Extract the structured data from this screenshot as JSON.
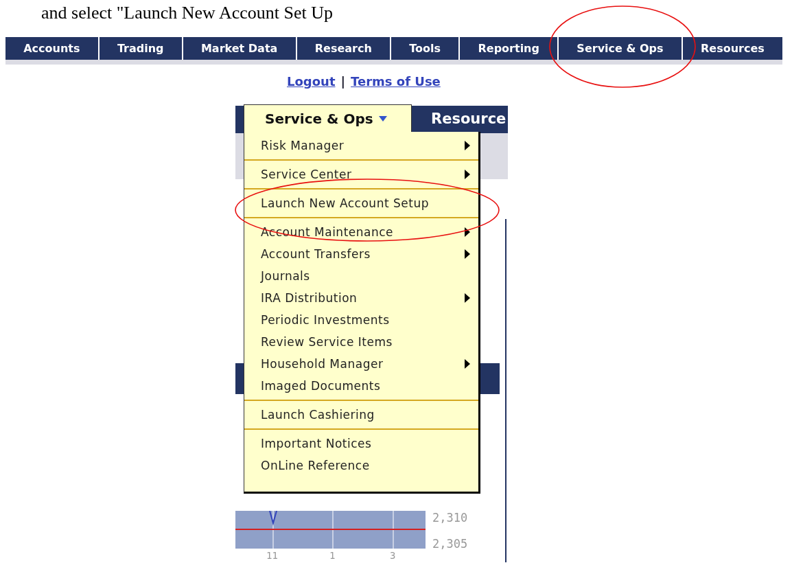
{
  "instruction": "and select \"Launch New Account Set Up",
  "nav": [
    "Accounts",
    "Trading",
    "Market Data",
    "Research",
    "Tools",
    "Reporting",
    "Service & Ops",
    "Resources"
  ],
  "links": [
    "Logout",
    "Terms of Use"
  ],
  "link_separator": "|",
  "back_tab": "Resource",
  "menu": {
    "title": "Service & Ops",
    "groups": [
      {
        "items": [
          {
            "label": "Risk Manager",
            "submenu": true
          }
        ]
      },
      {
        "items": [
          {
            "label": "Service Center",
            "submenu": true
          }
        ]
      },
      {
        "items": [
          {
            "label": "Launch New Account Setup",
            "submenu": false
          }
        ]
      },
      {
        "items": [
          {
            "label": "Account Maintenance",
            "submenu": true
          },
          {
            "label": "Account Transfers",
            "submenu": true
          },
          {
            "label": "Journals",
            "submenu": false
          },
          {
            "label": "IRA Distribution",
            "submenu": true
          },
          {
            "label": "Periodic Investments",
            "submenu": false
          },
          {
            "label": "Review Service Items",
            "submenu": false
          },
          {
            "label": "Household Manager",
            "submenu": true
          },
          {
            "label": "Imaged Documents",
            "submenu": false
          }
        ]
      },
      {
        "items": [
          {
            "label": "Launch Cashiering",
            "submenu": false
          }
        ]
      },
      {
        "items": [
          {
            "label": "Important Notices",
            "submenu": false
          },
          {
            "label": "OnLine Reference",
            "submenu": false
          }
        ]
      }
    ]
  },
  "chart_labels": {
    "y_labels": [
      "2,310",
      "2,305"
    ],
    "x_labels": [
      "11",
      "1",
      "3"
    ]
  }
}
